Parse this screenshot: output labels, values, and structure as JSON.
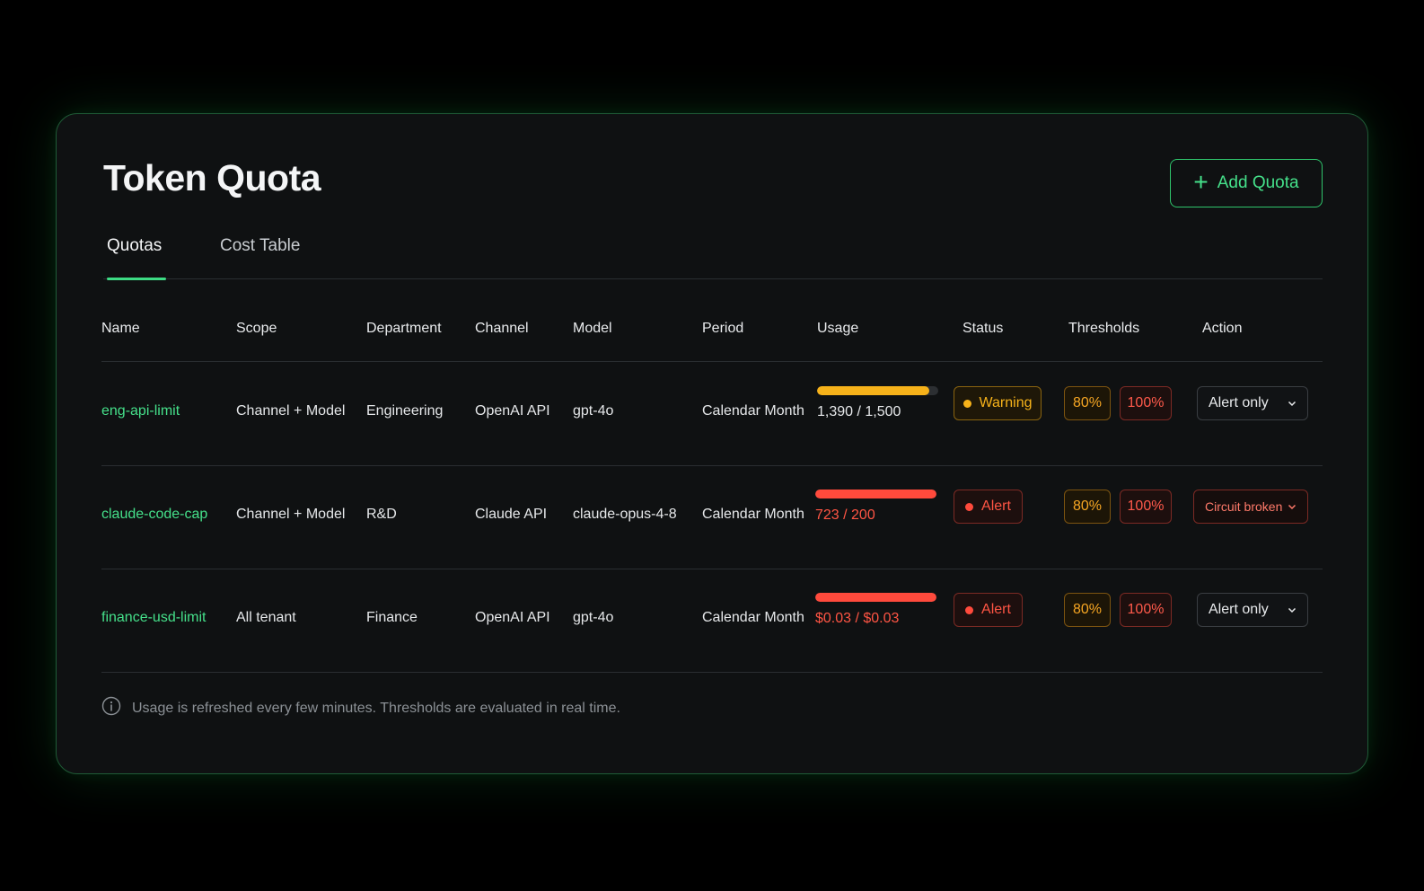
{
  "header": {
    "title": "Token Quota",
    "add_button": "Add Quota"
  },
  "tabs": [
    {
      "label": "Quotas",
      "active": true
    },
    {
      "label": "Cost Table",
      "active": false
    }
  ],
  "table": {
    "columns": [
      "Name",
      "Scope",
      "Department",
      "Channel",
      "Model",
      "Period",
      "Usage",
      "Status",
      "Thresholds",
      "Action"
    ],
    "rows": [
      {
        "name": "eng-api-limit",
        "scope": "Channel + Model",
        "department": "Engineering",
        "channel": "OpenAI API",
        "model": "gpt-4o",
        "period": "Calendar Month",
        "usage_text": "1,390 / 1,500",
        "usage_fraction": 0.927,
        "usage_color": "#f6b21a",
        "usage_text_color": "#e6e8ea",
        "status": "Warning",
        "status_kind": "warning",
        "threshold_1": "80%",
        "threshold_2": "100%",
        "action": "Alert only",
        "action_kind": "normal"
      },
      {
        "name": "claude-code-cap",
        "scope": "Channel + Model",
        "department": "R&D",
        "channel": "Claude API",
        "model": "claude-opus-4-8",
        "period": "Calendar Month",
        "usage_text": "723 / 200",
        "usage_fraction": 1.0,
        "usage_color": "#ff4a3c",
        "usage_text_color": "#ff5544",
        "status": "Alert",
        "status_kind": "alert",
        "threshold_1": "80%",
        "threshold_2": "100%",
        "action": "Circuit broken",
        "action_kind": "danger"
      },
      {
        "name": "finance-usd-limit",
        "scope": "All tenant",
        "department": "Finance",
        "channel": "OpenAI API",
        "model": "gpt-4o",
        "period": "Calendar Month",
        "usage_text": "$0.03 / $0.03",
        "usage_fraction": 1.0,
        "usage_color": "#ff4a3c",
        "usage_text_color": "#ff5544",
        "status": "Alert",
        "status_kind": "alert",
        "threshold_1": "80%",
        "threshold_2": "100%",
        "action": "Alert only",
        "action_kind": "normal"
      }
    ]
  },
  "footer": {
    "note": "Usage is refreshed every few minutes. Thresholds are evaluated in real time."
  },
  "icons": {
    "add": "plus-icon",
    "info": "info-icon",
    "dropdown": "chevron-down-icon",
    "status": "status-dot-icon"
  },
  "colors": {
    "accent": "#45e08a",
    "warning": "#f6b21a",
    "alert": "#ff4a3c"
  }
}
